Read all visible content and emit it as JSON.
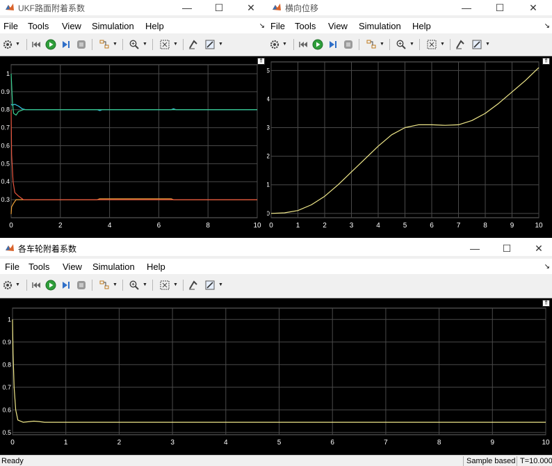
{
  "colors": {
    "plot_bg": "#000000",
    "grid": "#4a4a4a",
    "axis_text": "#ffffff",
    "yellow": "#f0e88a",
    "cyan": "#35c7e8",
    "green": "#38cf90",
    "red": "#e8553e",
    "orange": "#f2a33a"
  },
  "menu": [
    "File",
    "Tools",
    "View",
    "Simulation",
    "Help"
  ],
  "toolbar_icons": [
    "gear-icon",
    "restart-icon",
    "run-icon",
    "step-forward-icon",
    "stop-icon",
    "highlight-block-icon",
    "zoom-icon",
    "fit-to-view-icon",
    "autoscale-icon",
    "style-icon"
  ],
  "windows": [
    {
      "id": "ukf",
      "title": "UKF路面附着系数",
      "active": false
    },
    {
      "id": "lateral",
      "title": "横向位移",
      "active": false
    },
    {
      "id": "wheels",
      "title": "各车轮附着系数",
      "active": true
    }
  ],
  "chart_data": [
    {
      "type": "line",
      "title": "",
      "xlabel": "",
      "ylabel": "",
      "xlim": [
        0,
        10
      ],
      "ylim": [
        0.2,
        1.05
      ],
      "xticks": [
        "0",
        "2",
        "4",
        "6",
        "8",
        "10"
      ],
      "yticks": [
        "0.3",
        "0.4",
        "0.5",
        "0.6",
        "0.7",
        "0.8",
        "0.9",
        "1"
      ],
      "grid": true,
      "series": [
        {
          "color": "#35c7e8",
          "x": [
            0,
            0.05,
            0.15,
            0.3,
            0.45,
            0.6,
            3.5,
            3.6,
            3.7,
            6.5,
            6.6,
            6.7,
            10
          ],
          "y": [
            0.83,
            0.825,
            0.83,
            0.82,
            0.805,
            0.8,
            0.8,
            0.795,
            0.8,
            0.8,
            0.805,
            0.8,
            0.8
          ]
        },
        {
          "color": "#38cf90",
          "x": [
            0,
            0.05,
            0.1,
            0.2,
            0.3,
            0.5,
            1.0,
            10
          ],
          "y": [
            1.0,
            0.85,
            0.78,
            0.77,
            0.79,
            0.8,
            0.8,
            0.8
          ]
        },
        {
          "color": "#f2a33a",
          "x": [
            0,
            0.02,
            0.1,
            0.2,
            0.35,
            0.6,
            3.5,
            3.6,
            6.5,
            6.6,
            10
          ],
          "y": [
            0.22,
            0.26,
            0.28,
            0.3,
            0.3,
            0.3,
            0.3,
            0.305,
            0.305,
            0.3,
            0.3
          ]
        },
        {
          "color": "#e8553e",
          "x": [
            0,
            0.02,
            0.08,
            0.15,
            0.3,
            0.5,
            10
          ],
          "y": [
            0.8,
            0.55,
            0.4,
            0.34,
            0.32,
            0.3,
            0.3
          ]
        }
      ]
    },
    {
      "type": "line",
      "title": "",
      "xlabel": "",
      "ylabel": "",
      "xlim": [
        0,
        10
      ],
      "ylim": [
        -0.15,
        5.3
      ],
      "xticks": [
        "0",
        "1",
        "2",
        "3",
        "4",
        "5",
        "6",
        "7",
        "8",
        "9",
        "10"
      ],
      "yticks": [
        "0",
        "1",
        "2",
        "3",
        "4",
        "5"
      ],
      "grid": true,
      "series": [
        {
          "color": "#f0e88a",
          "x": [
            0,
            0.5,
            1,
            1.5,
            2,
            2.5,
            3,
            3.5,
            4,
            4.5,
            5,
            5.5,
            6,
            6.5,
            7,
            7.5,
            8,
            8.5,
            9,
            9.5,
            10
          ],
          "y": [
            0,
            0.02,
            0.1,
            0.3,
            0.6,
            1.0,
            1.45,
            1.9,
            2.35,
            2.75,
            3.0,
            3.1,
            3.1,
            3.08,
            3.1,
            3.25,
            3.5,
            3.85,
            4.25,
            4.65,
            5.1
          ]
        }
      ]
    },
    {
      "type": "line",
      "title": "",
      "xlabel": "",
      "ylabel": "",
      "xlim": [
        0,
        10
      ],
      "ylim": [
        0.49,
        1.05
      ],
      "xticks": [
        "0",
        "1",
        "2",
        "3",
        "4",
        "5",
        "6",
        "7",
        "8",
        "9",
        "10"
      ],
      "yticks": [
        "0.5",
        "0.6",
        "0.7",
        "0.8",
        "0.9",
        "1"
      ],
      "grid": true,
      "series": [
        {
          "color": "#f0e88a",
          "x": [
            0,
            0.01,
            0.03,
            0.06,
            0.1,
            0.2,
            0.4,
            0.5,
            0.6,
            1.0,
            10
          ],
          "y": [
            1.0,
            0.85,
            0.7,
            0.6,
            0.555,
            0.545,
            0.55,
            0.548,
            0.545,
            0.545,
            0.545
          ]
        }
      ]
    }
  ],
  "status": {
    "ready": "Ready",
    "sample": "Sample based",
    "time": "T=10.000"
  }
}
